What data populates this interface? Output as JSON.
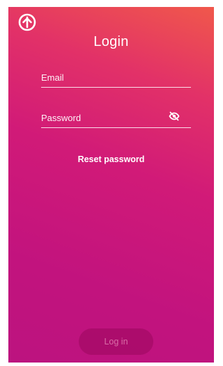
{
  "screen": {
    "title": "Login",
    "logo_icon": "rocket-logo-icon",
    "gradient_colors": [
      "#f0584b",
      "#e23168",
      "#d11a78",
      "#bc137f"
    ]
  },
  "form": {
    "email_label": "Email",
    "password_label": "Password",
    "password_toggle_icon": "eye-off-icon"
  },
  "actions": {
    "reset_password_label": "Reset password",
    "login_button_label": "Log in",
    "login_enabled": false
  }
}
